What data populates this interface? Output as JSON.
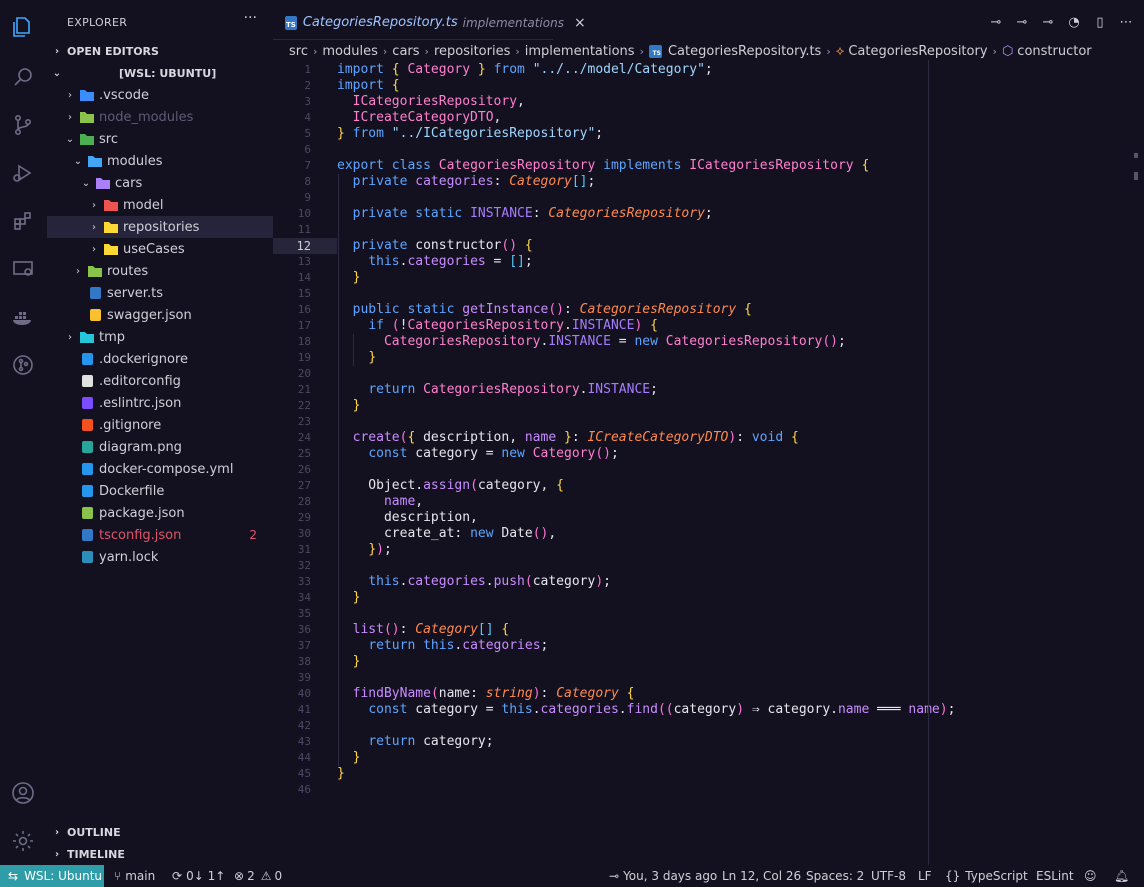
{
  "sidebar": {
    "title": "EXPLORER",
    "more": "···",
    "open_editors": "OPEN EDITORS",
    "workspace": "[WSL: UBUNTU]",
    "outline": "OUTLINE",
    "timeline": "TIMELINE",
    "tree": [
      {
        "label": ".vscode",
        "icon": "vscode-folder-icon",
        "color": "#3b8cff",
        "chev": "›"
      },
      {
        "label": "node_modules",
        "icon": "node-folder-icon",
        "color": "#8bc34a",
        "chev": "›",
        "dim": true
      },
      {
        "label": "src",
        "icon": "src-folder-icon",
        "color": "#4caf50",
        "chev": "⌄"
      },
      {
        "label": "modules",
        "icon": "modules-folder-icon",
        "color": "#42a5f5",
        "chev": "⌄"
      },
      {
        "label": "cars",
        "icon": "folder-open-icon",
        "color": "#ab7ff5",
        "chev": "⌄"
      },
      {
        "label": "model",
        "icon": "model-folder-icon",
        "color": "#ef5350",
        "chev": "›"
      },
      {
        "label": "repositories",
        "icon": "repositories-folder-icon",
        "color": "#fdd835",
        "chev": "›"
      },
      {
        "label": "useCases",
        "icon": "usecases-folder-icon",
        "color": "#fdd835",
        "chev": "›"
      },
      {
        "label": "routes",
        "icon": "routes-folder-icon",
        "color": "#8bc34a",
        "chev": "›"
      },
      {
        "label": "server.ts",
        "icon": "typescript-file-icon",
        "color": "#3178c6",
        "chev": ""
      },
      {
        "label": "swagger.json",
        "icon": "json-file-icon",
        "color": "#fbc02d",
        "chev": ""
      },
      {
        "label": "tmp",
        "icon": "tmp-folder-icon",
        "color": "#26c6da",
        "chev": "›"
      },
      {
        "label": ".dockerignore",
        "icon": "docker-file-icon",
        "color": "#2496ed",
        "chev": ""
      },
      {
        "label": ".editorconfig",
        "icon": "editorconfig-file-icon",
        "color": "#e0e0e0",
        "chev": ""
      },
      {
        "label": ".eslintrc.json",
        "icon": "eslint-file-icon",
        "color": "#7c4dff",
        "chev": ""
      },
      {
        "label": ".gitignore",
        "icon": "git-file-icon",
        "color": "#f4511e",
        "chev": ""
      },
      {
        "label": "diagram.png",
        "icon": "image-file-icon",
        "color": "#26a69a",
        "chev": ""
      },
      {
        "label": "docker-compose.yml",
        "icon": "docker-file-icon",
        "color": "#2496ed",
        "chev": ""
      },
      {
        "label": "Dockerfile",
        "icon": "docker-file-icon",
        "color": "#2496ed",
        "chev": ""
      },
      {
        "label": "package.json",
        "icon": "nodejs-file-icon",
        "color": "#8bc34a",
        "chev": ""
      },
      {
        "label": "tsconfig.json",
        "icon": "tsconfig-file-icon",
        "color": "#3178c6",
        "chev": "",
        "error": "2"
      },
      {
        "label": "yarn.lock",
        "icon": "yarn-file-icon",
        "color": "#2c8ebb",
        "chev": ""
      }
    ]
  },
  "tab": {
    "name": "CategoriesRepository.ts",
    "description": "implementations",
    "ts_badge": "TS",
    "close": "×"
  },
  "breadcrumb": [
    "src",
    "modules",
    "cars",
    "repositories",
    "implementations",
    "CategoriesRepository.ts",
    "CategoriesRepository",
    "constructor"
  ],
  "status": {
    "remote": "WSL: Ubuntu",
    "branch": "main",
    "sync": "0↓ 1↑",
    "problems": "2",
    "warnings": "0",
    "blame": "You, 3 days ago",
    "position": "Ln 12, Col 26",
    "spaces": "Spaces: 2",
    "encoding": "UTF-8",
    "eol": "LF",
    "language": "TypeScript",
    "linter": "ESLint"
  },
  "current_line": 12,
  "code_lines": [
    "import { Category } from \"../../model/Category\";",
    "import {",
    "  ICategoriesRepository,",
    "  ICreateCategoryDTO,",
    "} from \"../ICategoriesRepository\";",
    "",
    "export class CategoriesRepository implements ICategoriesRepository {",
    "  private categories: Category[];",
    "",
    "  private static INSTANCE: CategoriesRepository;",
    "",
    "  private constructor() {",
    "    this.categories = [];",
    "  }",
    "",
    "  public static getInstance(): CategoriesRepository {",
    "    if (!CategoriesRepository.INSTANCE) {",
    "      CategoriesRepository.INSTANCE = new CategoriesRepository();",
    "    }",
    "",
    "    return CategoriesRepository.INSTANCE;",
    "  }",
    "",
    "  create({ description, name }: ICreateCategoryDTO): void {",
    "    const category = new Category();",
    "",
    "    Object.assign(category, {",
    "      name,",
    "      description,",
    "      create_at: new Date(),",
    "    });",
    "",
    "    this.categories.push(category);",
    "  }",
    "",
    "  list(): Category[] {",
    "    return this.categories;",
    "  }",
    "",
    "  findByName(name: string): Category {",
    "    const category = this.categories.find((category) ⇒ category.name ═══ name);",
    "",
    "    return category;",
    "  }",
    "}",
    ""
  ]
}
